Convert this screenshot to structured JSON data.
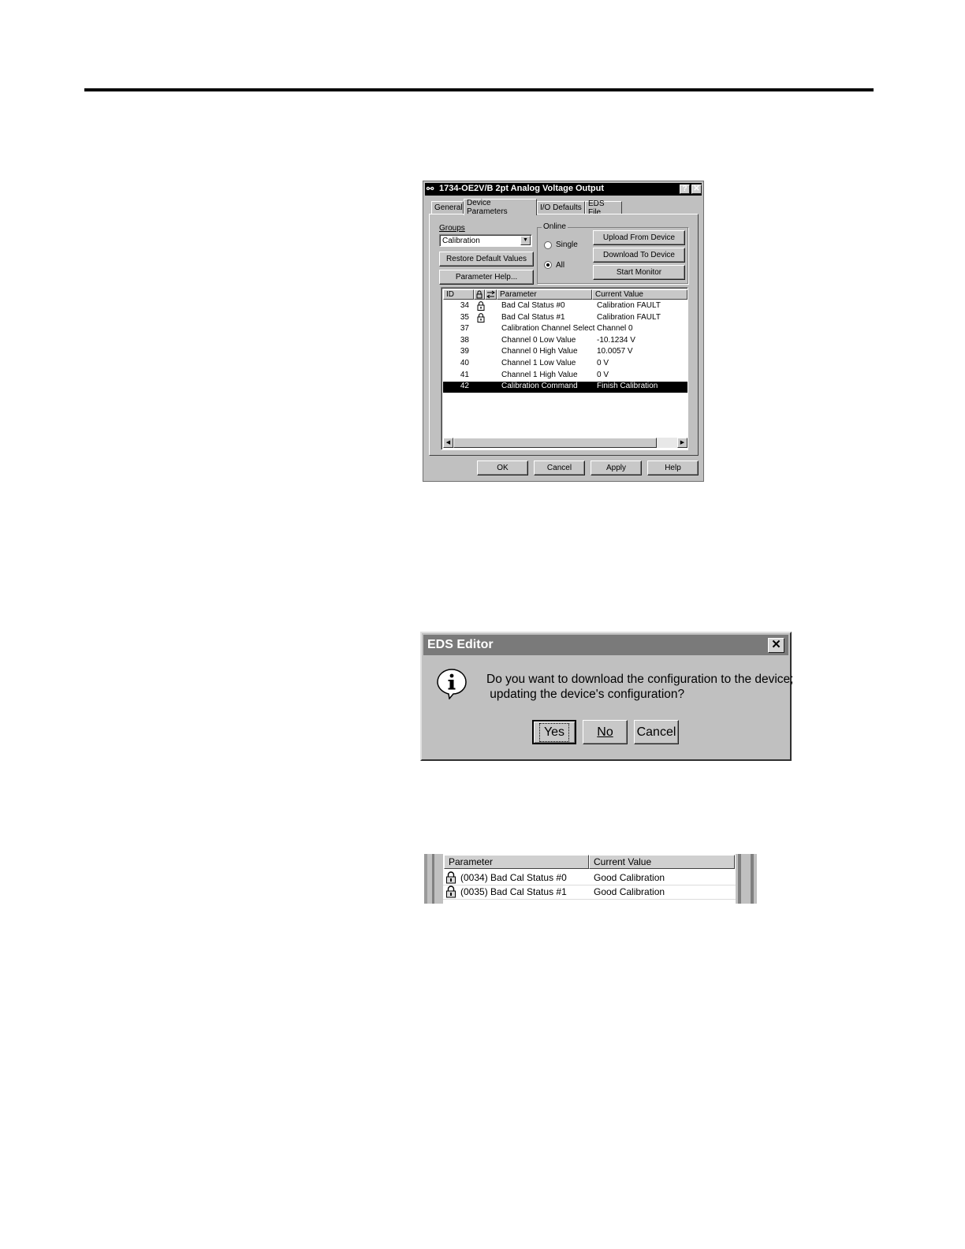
{
  "page": {
    "rule_color": "#000000"
  },
  "dialog1": {
    "title": "1734-OE2V/B 2pt Analog Voltage Output",
    "help_glyph": "?",
    "close_glyph": "✕",
    "tabs": [
      "General",
      "Device Parameters",
      "I/O Defaults",
      "EDS File"
    ],
    "groups_label": "Groups",
    "groups_value": "Calibration",
    "restore_button": "Restore Default Values",
    "param_help_button": "Parameter Help...",
    "online_label": "Online",
    "radio_single": "Single",
    "radio_all": "All",
    "selected_radio": "All",
    "upload_button": "Upload From Device",
    "download_button": "Download To Device",
    "monitor_button": "Start Monitor",
    "columns": [
      "ID",
      "Parameter",
      "Current Value"
    ],
    "rows": [
      {
        "id": "34",
        "locked": true,
        "param": "Bad Cal Status #0",
        "value": "Calibration FAULT"
      },
      {
        "id": "35",
        "locked": true,
        "param": "Bad Cal Status #1",
        "value": "Calibration FAULT"
      },
      {
        "id": "37",
        "locked": false,
        "param": "Calibration Channel Select",
        "value": "Channel 0"
      },
      {
        "id": "38",
        "locked": false,
        "param": "Channel 0 Low Value",
        "value": "-10.1234 V"
      },
      {
        "id": "39",
        "locked": false,
        "param": "Channel 0 High Value",
        "value": "10.0057 V"
      },
      {
        "id": "40",
        "locked": false,
        "param": "Channel 1 Low Value",
        "value": "0 V"
      },
      {
        "id": "41",
        "locked": false,
        "param": "Channel 1 High Value",
        "value": "0 V"
      },
      {
        "id": "42",
        "locked": false,
        "param": "Calibration Command",
        "value": "Finish Calibration",
        "selected": true
      }
    ],
    "ok_button": "OK",
    "cancel_button": "Cancel",
    "apply_button": "Apply",
    "help_button": "Help"
  },
  "dialog2": {
    "title": "EDS Editor",
    "message_line1": "Do you want to download the configuration to the device;",
    "message_line2": " updating the device's configuration?",
    "yes_button": "Yes",
    "no_button": "No",
    "cancel_button": "Cancel"
  },
  "snippet": {
    "columns": [
      "Parameter",
      "Current Value"
    ],
    "rows": [
      {
        "param": "(0034) Bad Cal Status #0",
        "value": "Good Calibration"
      },
      {
        "param": "(0035) Bad Cal Status #1",
        "value": "Good Calibration"
      }
    ]
  }
}
